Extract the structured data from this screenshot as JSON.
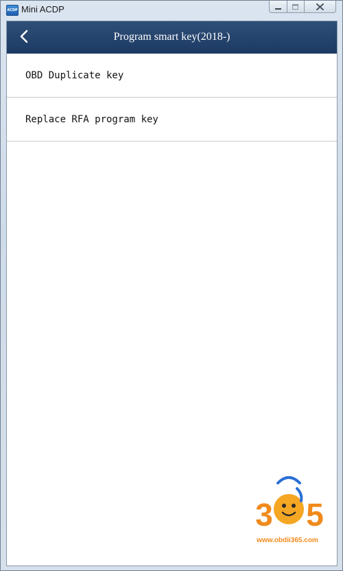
{
  "window": {
    "title": "Mini ACDP",
    "icon_text": "ACDP",
    "icon": "app-icon",
    "controls": [
      "minimize-icon",
      "maximize-icon",
      "close-icon"
    ]
  },
  "header": {
    "back_icon": "chevron-left-icon",
    "title": "Program smart key(2018-)"
  },
  "menu": {
    "items": [
      {
        "label": "OBD Duplicate key"
      },
      {
        "label": "Replace RFA program key"
      }
    ]
  },
  "watermark": {
    "digit_1": "3",
    "digit_2": "6",
    "digit_3": "5",
    "url": "www.obdii365.com"
  },
  "colors": {
    "header_bg": "#1c3a63",
    "header_text": "#ffffff",
    "watermark_orange": "#f08a1c"
  }
}
